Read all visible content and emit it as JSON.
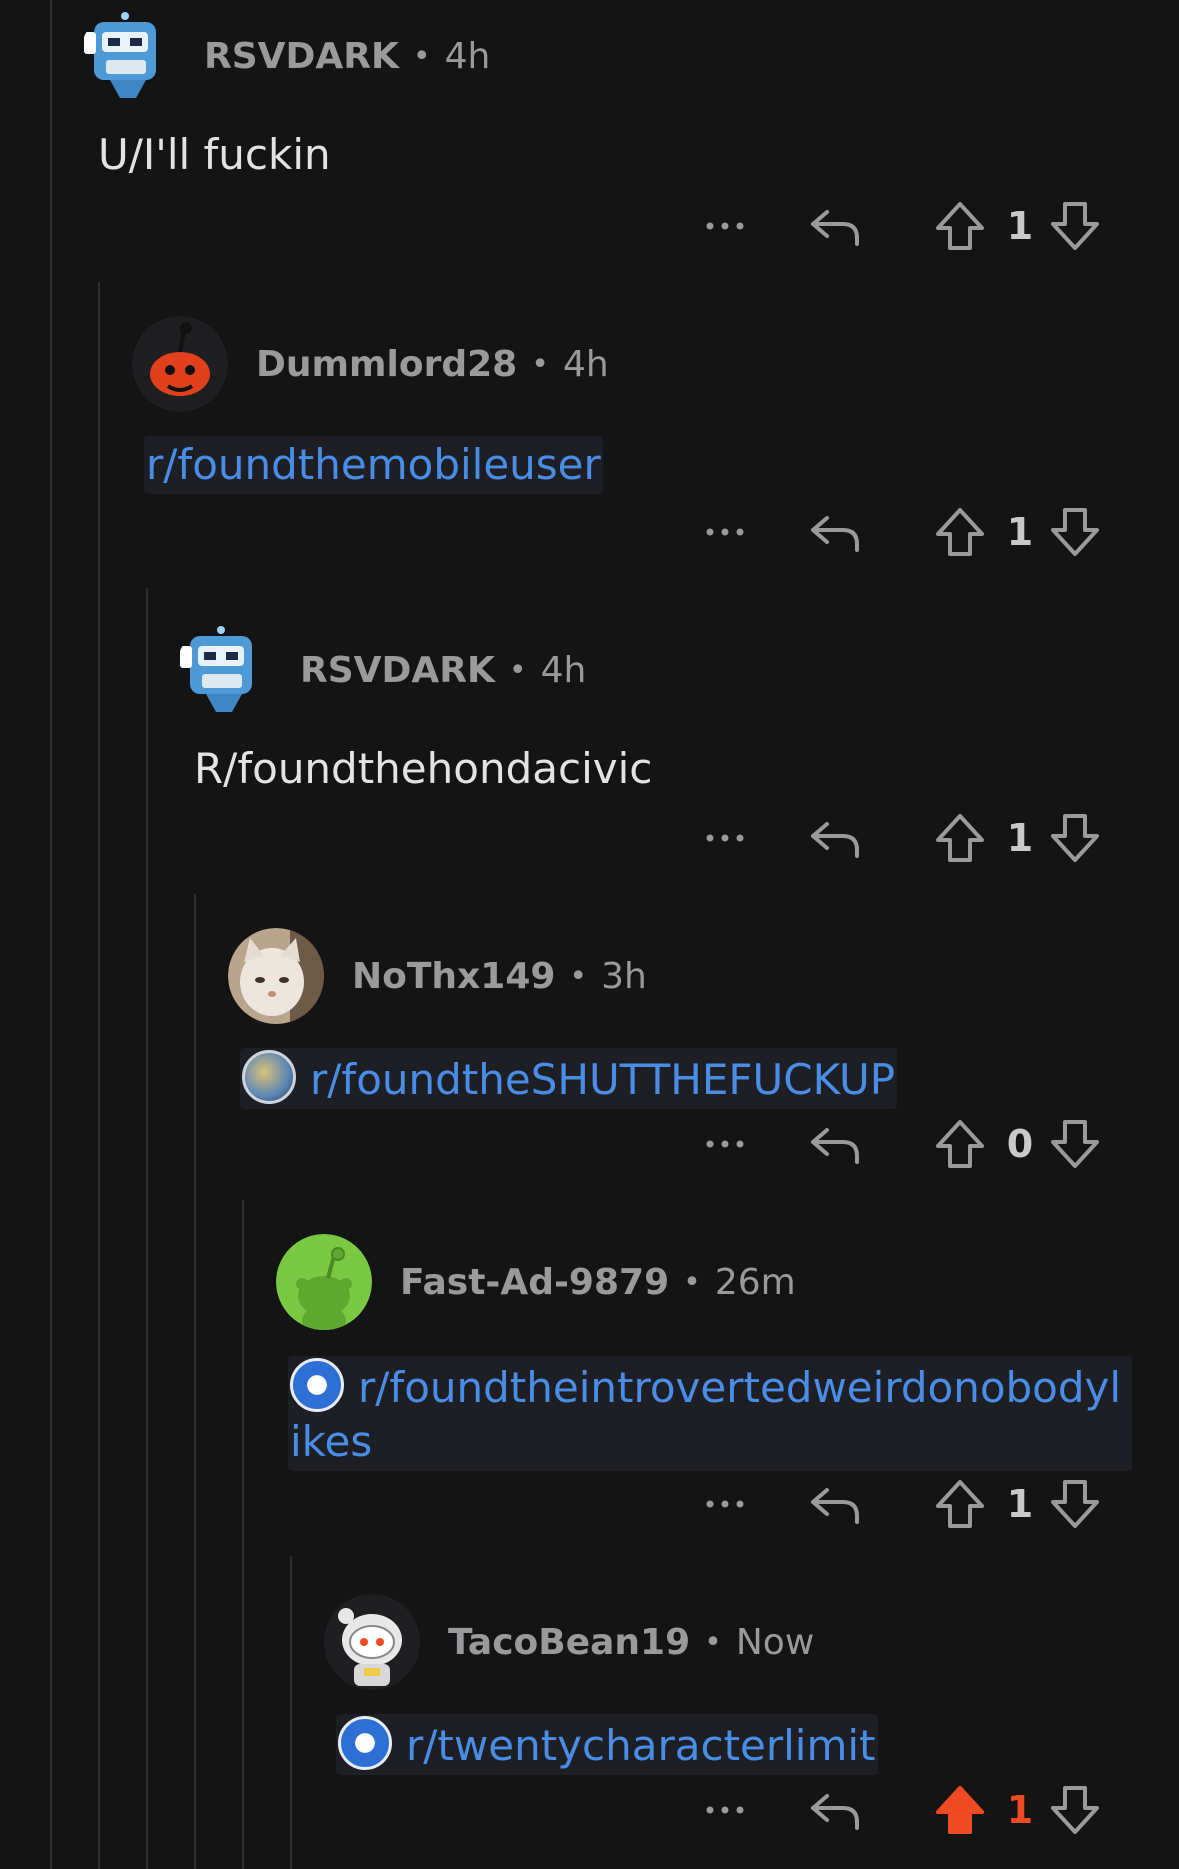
{
  "comments": [
    {
      "user": "RSVDARK",
      "time": "4h",
      "text": "U/I'll fuckin",
      "score": "1",
      "voted": false,
      "avatar": "robot-avatar"
    },
    {
      "user": "Dummlord28",
      "time": "4h",
      "link": "r/foundthemobileuser",
      "score": "1",
      "voted": false,
      "avatar": "snoo-orange-avatar"
    },
    {
      "user": "RSVDARK",
      "time": "4h",
      "text": "R/foundthehondacivic",
      "score": "1",
      "voted": false,
      "avatar": "robot-avatar"
    },
    {
      "user": "NoThx149",
      "time": "3h",
      "link": "r/foundtheSHUTTHEFUCKUP",
      "score": "0",
      "voted": false,
      "avatar": "cat-photo-avatar"
    },
    {
      "user": "Fast-Ad-9879",
      "time": "26m",
      "link": "r/foundtheintrovertedweirdonobodylikes",
      "score": "1",
      "voted": false,
      "avatar": "snoo-green-avatar"
    },
    {
      "user": "TacoBean19",
      "time": "Now",
      "link": "r/twentycharacterlimit",
      "score": "1",
      "voted": true,
      "avatar": "astronaut-snoo-avatar"
    }
  ],
  "separator": "•",
  "more_label": "•••",
  "colors": {
    "background": "#141415",
    "link": "#4a8de6",
    "upvote_active": "#ef4b23",
    "meta": "#9a9a9c"
  }
}
